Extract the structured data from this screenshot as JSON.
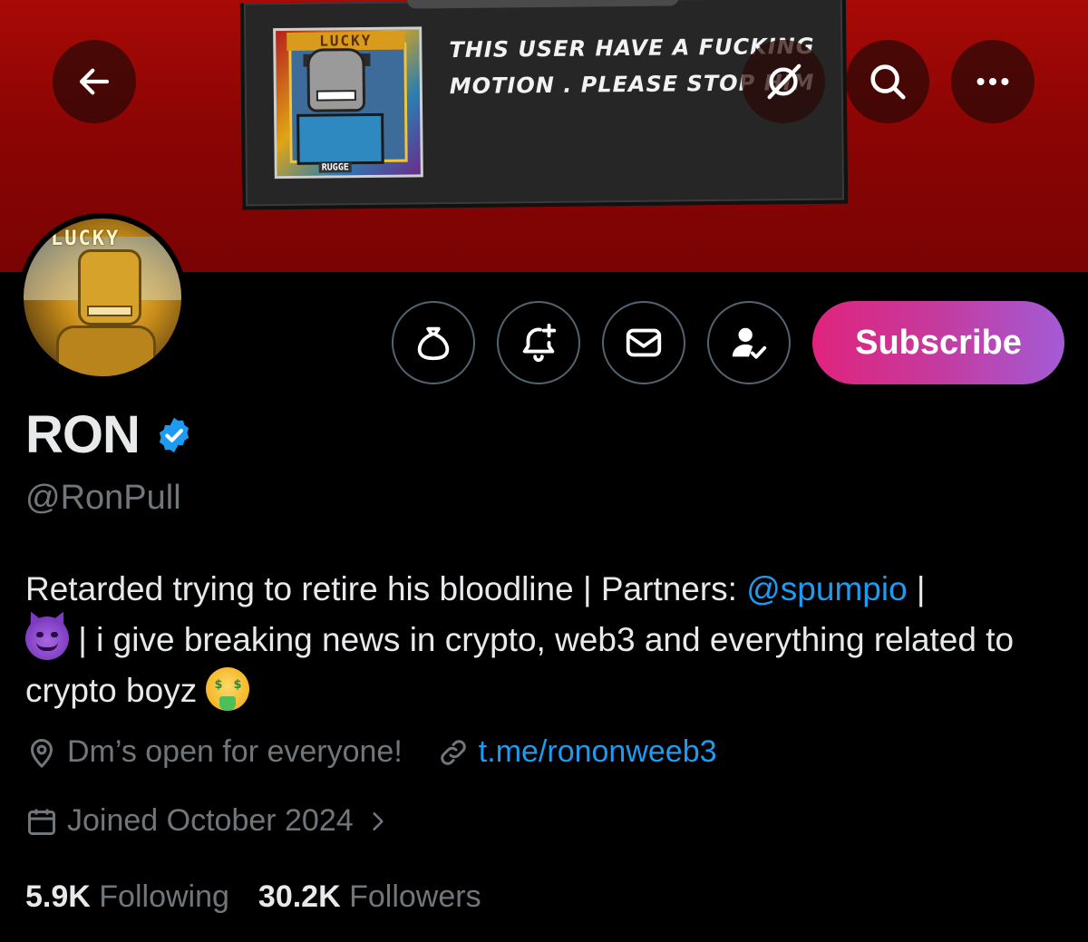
{
  "banner": {
    "meme_caption_line1": "THIS USER HAVE A FUCKING",
    "meme_caption_line2": "MOTION . PLEASE STOP HIM",
    "meme_thumb_top_text": "LUCKY",
    "meme_thumb_bottom_text": "RUGGE"
  },
  "header": {
    "back_icon": "arrow-left-icon",
    "grok_icon": "grok-icon",
    "search_icon": "search-icon",
    "more_icon": "more-horizontal-icon"
  },
  "avatar": {
    "text": "LUCKY"
  },
  "actions": {
    "tip_icon": "money-bag-icon",
    "notify_icon": "bell-plus-icon",
    "message_icon": "envelope-icon",
    "following_icon": "user-check-icon",
    "subscribe_label": "Subscribe"
  },
  "profile": {
    "display_name": "RON",
    "verified": true,
    "handle": "@RonPull",
    "bio_part1": "Retarded trying to retire his bloodline | Partners: ",
    "bio_mention": "@spumpio",
    "bio_part2": " |",
    "bio_part3": " | i give breaking news in crypto, web3 and everything related to crypto boyz ",
    "location": "Dm’s open for everyone!",
    "website": "t.me/rononweeb3",
    "joined": "Joined October 2024"
  },
  "stats": {
    "following_count": "5.9K",
    "following_label": "Following",
    "followers_count": "30.2K",
    "followers_label": "Followers"
  },
  "colors": {
    "banner_red": "#8c0504",
    "accent_blue": "#1d9bf0",
    "muted_gray": "#71767b",
    "subscribe_gradient_start": "#e0247d",
    "subscribe_gradient_end": "#a35bd6"
  }
}
